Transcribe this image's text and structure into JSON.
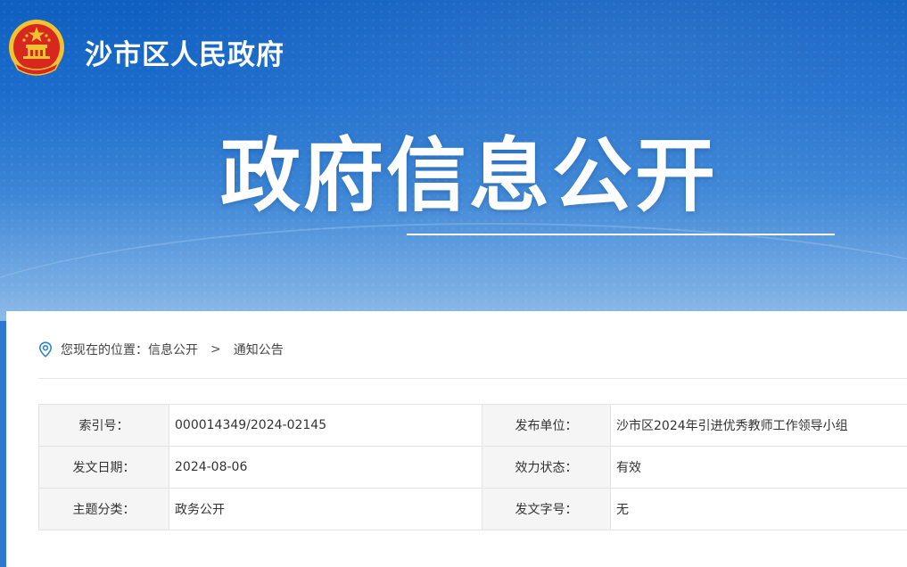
{
  "header": {
    "site_name": "沙市区人民政府",
    "title": "政府信息公开",
    "emblem": "national-emblem-icon"
  },
  "breadcrumb": {
    "prefix": "您现在的位置：",
    "items": [
      "信息公开",
      "通知公告"
    ],
    "separator": ">"
  },
  "meta_table": {
    "rows": [
      {
        "label1": "索引号：",
        "value1": "000014349/2024-02145",
        "label2": "发布单位：",
        "value2": "沙市区2024年引进优秀教师工作领导小组"
      },
      {
        "label1": "发文日期：",
        "value1": "2024-08-06",
        "label2": "效力状态：",
        "value2": "有效"
      },
      {
        "label1": "主题分类：",
        "value1": "政务公开",
        "label2": "发文字号：",
        "value2": "无"
      }
    ]
  },
  "colors": {
    "banner_top": "#0f5fc0",
    "banner_bottom": "#8dbbe8",
    "emblem_red": "#d6281e",
    "emblem_gold": "#f2c230",
    "accent_blue": "#2d86c9"
  }
}
